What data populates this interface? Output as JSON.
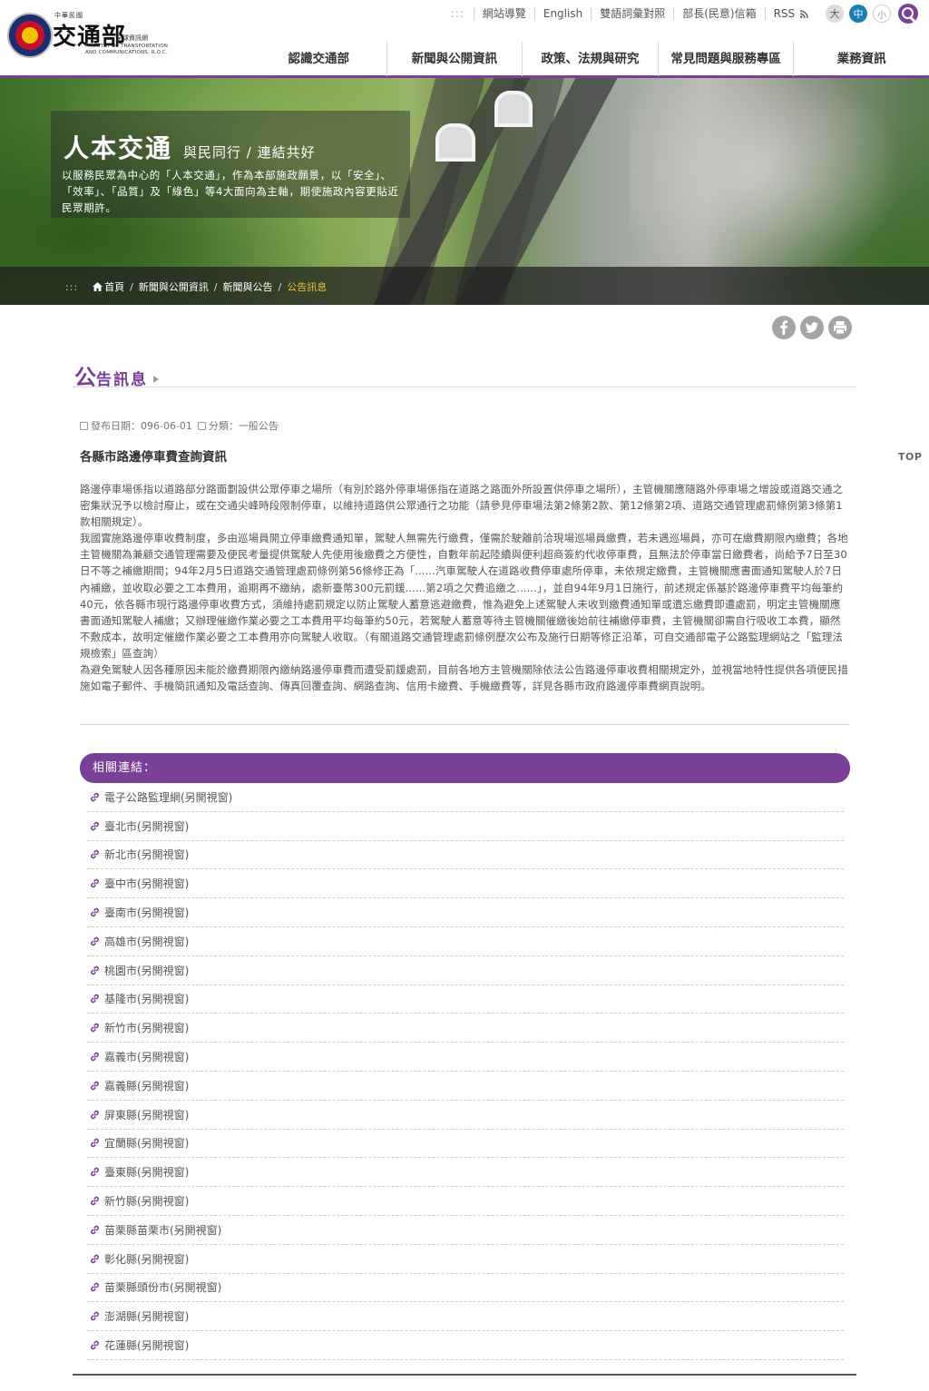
{
  "header": {
    "logo": {
      "cn_small": "中華民國",
      "cn_name": "交通部",
      "cn_sub": "全球資訊網",
      "en_line1": "MINISTRY OF TRANSPORTATION",
      "en_line2": "AND COMMUNICATIONS, R.O.C."
    },
    "util": {
      "accesskey": ":::",
      "sitemap": "網站導覽",
      "english": "English",
      "glossary": "雙語詞彙對照",
      "mailbox": "部長(民意)信箱",
      "rss": "RSS",
      "font_large": "大",
      "font_medium": "中",
      "font_small": "小"
    },
    "nav": [
      "認識交通部",
      "新聞與公開資訊",
      "政策、法規與研究",
      "常見問題與服務專區",
      "業務資訊"
    ]
  },
  "banner": {
    "title": "人本交通",
    "subtitle": "與民同行 / 連結共好",
    "text": "以服務民眾為中心的「人本交通」，作為本部施政願景，以「安全」、「效率」、「品質」及「綠色」等4大面向為主軸，期使施政內容更貼近民眾期許。"
  },
  "breadcrumb": {
    "accesskey": ":::",
    "items": [
      "首頁",
      "新聞與公開資訊",
      "新聞與公告",
      "公告訊息"
    ],
    "separator": "/"
  },
  "page": {
    "title_first": "公",
    "title_rest": "告訊息",
    "meta_date_label": "發布日期：",
    "meta_date": "096-06-01",
    "meta_category_label": "分類：",
    "meta_category": "一般公告",
    "notice_title": "各縣市路邊停車費查詢資訊",
    "paragraphs": [
      "路邊停車場係指以道路部分路面劃設供公眾停車之場所（有別於路外停車場係指在道路之路面外所設置供停車之場所），主管機關應隨路外停車場之增設或道路交通之密集狀況予以檢討廢止，或在交通尖峰時段限制停車，以維持道路供公眾通行之功能（請參見停車場法第2條第2款、第12條第2項、道路交通管理處罰條例第3條第1款相關規定）。",
      "我國實施路邊停車收費制度，多由巡場員開立停車繳費通知單，駕駛人無需先行繳費，僅需於駛離前洽現場巡場員繳費，若未遇巡場員，亦可在繳費期限內繳費；各地主管機關為兼顧交通管理需要及便民考量提供駕駛人先使用後繳費之方便性，自數年前起陸續與便利超商簽約代收停車費，且無法於停車當日繳費者，尚給予7日至30日不等之補繳期間；94年2月5日道路交通管理處罰條例第56條修正為「......汽車駕駛人在道路收費停車處所停車，未依規定繳費，主管機關應書面通知駕駛人於7日內補繳，並收取必要之工本費用，逾期再不繳納，處新臺幣300元罰鍰......第2項之欠費追繳之......」，並自94年9月1日施行，前述規定係基於路邊停車費平均每筆約40元，依各縣市現行路邊停車收費方式，須維持處罰規定以防止駕駛人蓄意逃避繳費，惟為避免上述駕駛人未收到繳費通知單或遺忘繳費即遭處罰，明定主管機關應書面通知駕駛人補繳；又辦理催繳作業必要之工本費用平均每筆約50元，若駕駛人蓄意等待主管機關催繳後始前往補繳停車費，主管機關卻需自行吸收工本費，顯然不敷成本，故明定催繳作業必要之工本費用亦向駕駛人收取。（有關道路交通管理處罰條例歷次公布及施行日期等修正沿革，可自交通部電子公路監理網站之「監理法規檢索」區查詢）",
      "為避免駕駛人因各種原因未能於繳費期限內繳納路邊停車費而遭受罰鍰處罰，目前各地方主管機關除依法公告路邊停車收費相關規定外，並視當地特性提供各項便民措施如電子郵件、手機簡訊通知及電話查詢、傳真回覆查詢、網路查詢、信用卡繳費、手機繳費等，詳見各縣市政府路邊停車費網頁說明。"
    ],
    "top_label": "TOP"
  },
  "related": {
    "heading": "相關連結：",
    "links": [
      "電子公路監理網(另開視窗)",
      "臺北市(另開視窗)",
      "新北市(另開視窗)",
      "臺中市(另開視窗)",
      "臺南市(另開視窗)",
      "高雄市(另開視窗)",
      "桃園市(另開視窗)",
      "基隆市(另開視窗)",
      "新竹市(另開視窗)",
      "嘉義市(另開視窗)",
      "嘉義縣(另開視窗)",
      "屏東縣(另開視窗)",
      "宜蘭縣(另開視窗)",
      "臺東縣(另開視窗)",
      "新竹縣(另開視窗)",
      "苗栗縣苗栗市(另開視窗)",
      "彰化縣(另開視窗)",
      "苗栗縣頭份市(另開視窗)",
      "澎湖縣(另開視窗)",
      "花蓮縣(另開視窗)"
    ]
  },
  "colors": {
    "brand_purple": "#7a3f96",
    "accent_blue": "#1a7db5",
    "breadcrumb_current": "#f0c040"
  },
  "icons": {
    "home": "home-icon",
    "calendar": "calendar-icon",
    "category": "category-icon",
    "link": "link-icon",
    "facebook": "facebook-icon",
    "twitter": "twitter-icon",
    "print": "print-icon",
    "search": "search-icon",
    "rss": "rss-icon"
  }
}
